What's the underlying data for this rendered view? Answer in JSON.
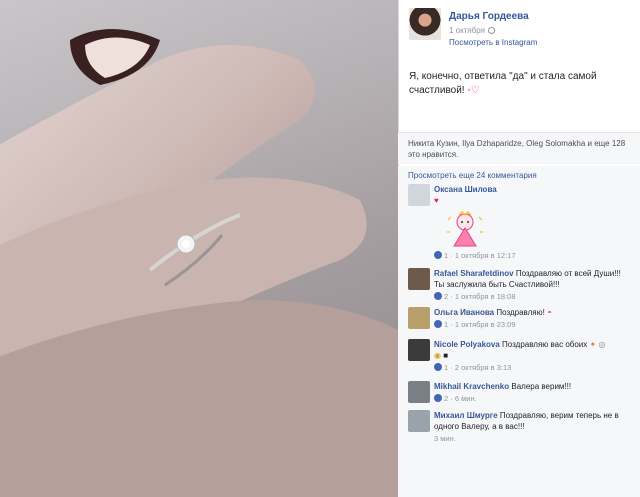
{
  "post": {
    "author": "Дарья Гордеева",
    "date": "1 октября",
    "view_on_instagram": "Посмотреть в Instagram",
    "caption": "Я, конечно, ответила \"да\" и стала самой счастливой!",
    "likes": "Никита Кузин, Ilya Dzhaparidze, Oleg Solomakha и еще 128 это нравится.",
    "more_comments": "Просмотреть еще 24 комментария"
  },
  "comments": [
    {
      "name": "Оксана Шилова",
      "text": "",
      "likes": "1",
      "time": "1 октября в 12:17",
      "avatar_color": "#cfd6dc"
    },
    {
      "name": "Rafael Sharafetdinov",
      "text": "Поздравляю от всей Души!!!Ты заслужила быть Счастливой!!!",
      "likes": "2",
      "time": "1 октября в 18:08",
      "avatar_color": "#6e5a4a"
    },
    {
      "name": "Ольга Иванова",
      "text": "Поздравляю!",
      "likes": "1",
      "time": "1 октября в 23:09",
      "avatar_color": "#b9a06a"
    },
    {
      "name": "Nicole Polyakova",
      "text": "Поздравляю вас обоих",
      "likes": "1",
      "time": "2 октября в 3:13",
      "avatar_color": "#3b3b3b"
    },
    {
      "name": "Mikhail Kravchenko",
      "text": "Валера верим!!!",
      "likes": "2",
      "time": "6 мин.",
      "avatar_color": "#7a7f86"
    },
    {
      "name": "Михаил Шмурге",
      "text": "Поздравляю, верим теперь не в одного Валеру, а в вас!!!",
      "likes": "",
      "time": "3 мин.",
      "avatar_color": "#9aa3ab"
    }
  ],
  "colors": {
    "link": "#365899",
    "meta": "#90949c",
    "like": "#4267b2"
  }
}
